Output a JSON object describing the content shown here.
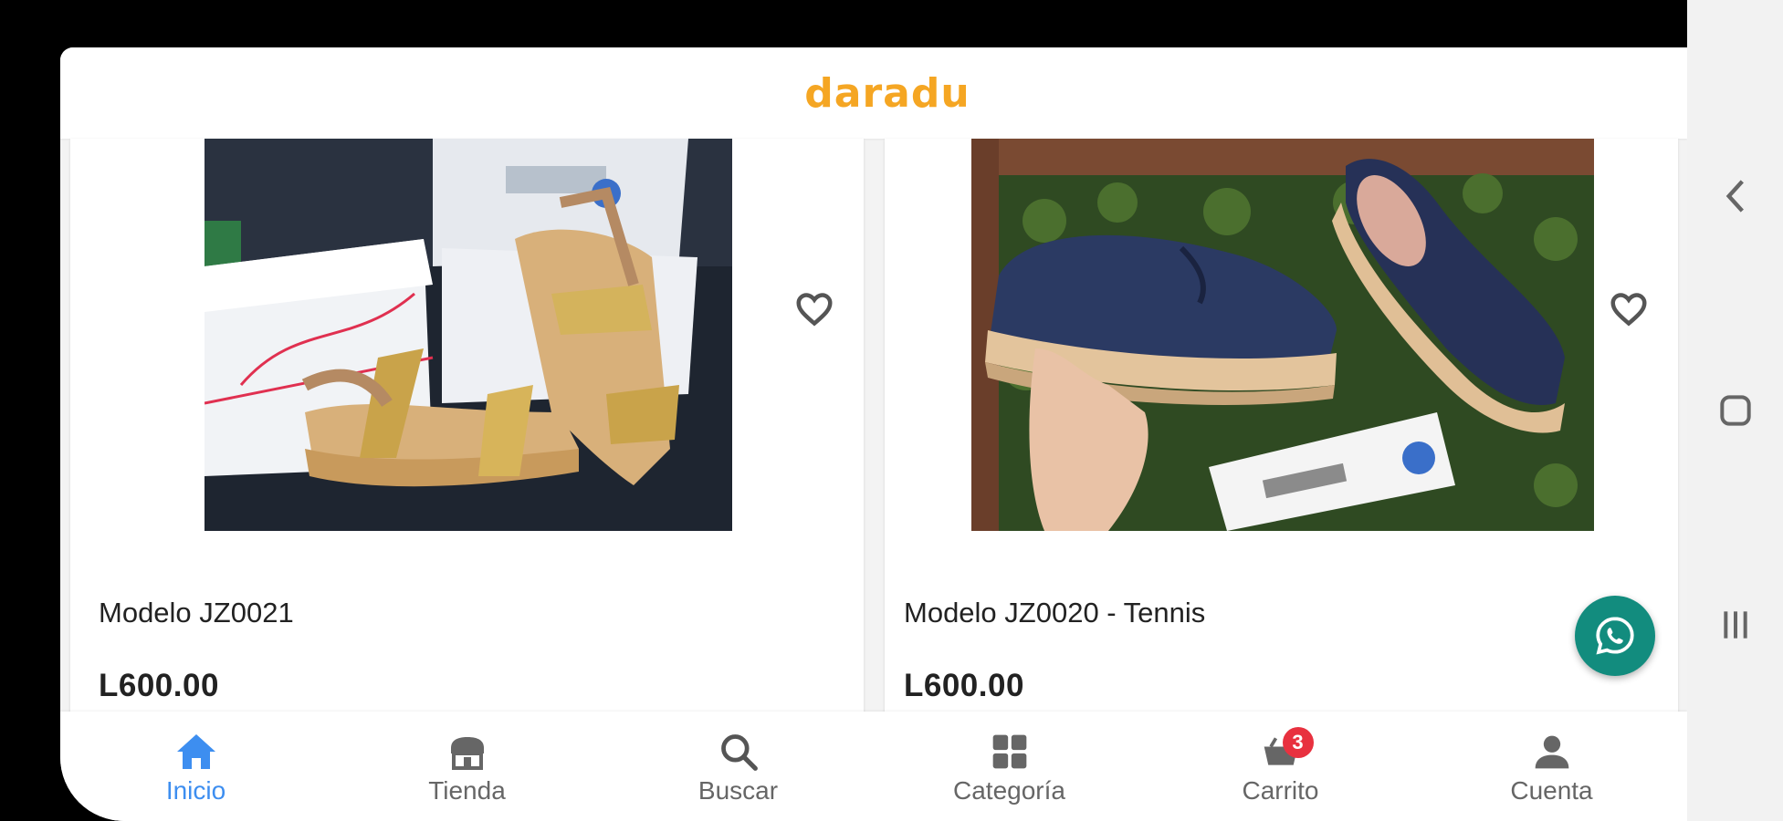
{
  "app": {
    "brand": "daradu",
    "brand_color": "#f5a623"
  },
  "products": [
    {
      "name": "Modelo JZ0021",
      "price": "L600.00",
      "favorite_icon": "heart-outline-icon"
    },
    {
      "name": "Modelo JZ0020 - Tennis",
      "price": "L600.00",
      "favorite_icon": "heart-outline-icon"
    }
  ],
  "floating_button": {
    "icon": "whatsapp-icon",
    "color": "#128c7e"
  },
  "bottom_nav": {
    "active_color": "#3d8ef0",
    "items": [
      {
        "label": "Inicio",
        "icon": "home-icon",
        "active": true
      },
      {
        "label": "Tienda",
        "icon": "store-icon"
      },
      {
        "label": "Buscar",
        "icon": "search-icon"
      },
      {
        "label": "Categoría",
        "icon": "grid-icon"
      },
      {
        "label": "Carrito",
        "icon": "cart-icon",
        "badge": "3",
        "badge_color": "#e8313f"
      },
      {
        "label": "Cuenta",
        "icon": "account-icon"
      }
    ]
  },
  "system_nav": {
    "buttons": [
      "back-icon",
      "home-square-icon",
      "recents-icon"
    ]
  }
}
